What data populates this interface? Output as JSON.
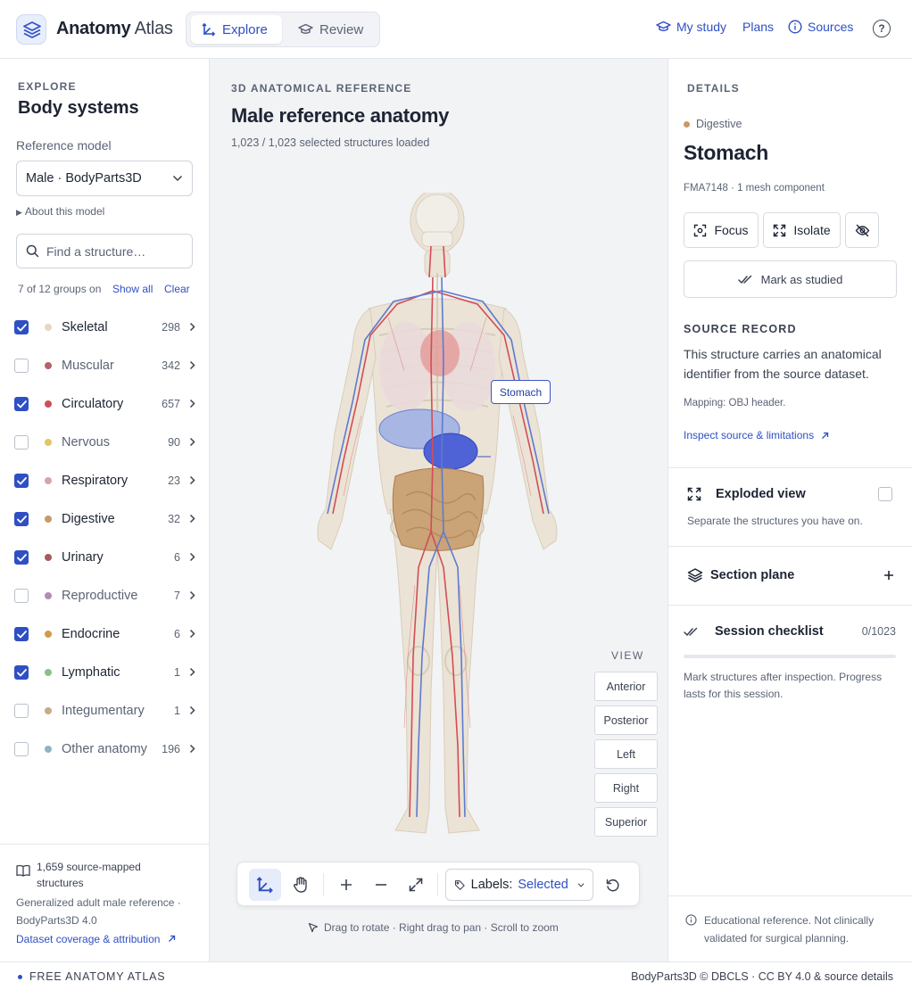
{
  "app": {
    "brand_bold": "Anatomy",
    "brand_light": "Atlas"
  },
  "modes": [
    {
      "label": "Explore",
      "active": true
    },
    {
      "label": "Review",
      "active": false
    }
  ],
  "toplinks": {
    "my_study": "My study",
    "plans": "Plans",
    "sources": "Sources",
    "help": "?"
  },
  "sidebar": {
    "eyebrow": "EXPLORE",
    "title": "Body systems",
    "model_label": "Reference model",
    "model_value": "Male · BodyParts3D",
    "about": "About this model",
    "search_placeholder": "Find a structure…",
    "group_summary": "7 of 12 groups on",
    "show_all": "Show all",
    "clear": "Clear",
    "groups": [
      {
        "name": "Skeletal",
        "count": "298",
        "on": true,
        "color": "#e6d9bf"
      },
      {
        "name": "Muscular",
        "count": "342",
        "on": false,
        "color": "#b5636a"
      },
      {
        "name": "Circulatory",
        "count": "657",
        "on": true,
        "color": "#d24d57"
      },
      {
        "name": "Nervous",
        "count": "90",
        "on": false,
        "color": "#e1c760"
      },
      {
        "name": "Respiratory",
        "count": "23",
        "on": true,
        "color": "#d9a3a7"
      },
      {
        "name": "Digestive",
        "count": "32",
        "on": true,
        "color": "#c79a6a"
      },
      {
        "name": "Urinary",
        "count": "6",
        "on": true,
        "color": "#a65a5e"
      },
      {
        "name": "Reproductive",
        "count": "7",
        "on": false,
        "color": "#b48bb5"
      },
      {
        "name": "Endocrine",
        "count": "6",
        "on": true,
        "color": "#d29a4a"
      },
      {
        "name": "Lymphatic",
        "count": "1",
        "on": true,
        "color": "#8dbf8b"
      },
      {
        "name": "Integumentary",
        "count": "1",
        "on": false,
        "color": "#c8ab87"
      },
      {
        "name": "Other anatomy",
        "count": "196",
        "on": false,
        "color": "#8db5c3"
      }
    ],
    "footer": {
      "mapped": "1,659 source-mapped structures",
      "desc": "Generalized adult male reference · BodyParts3D 4.0",
      "link": "Dataset coverage & attribution"
    }
  },
  "main": {
    "eyebrow": "3D ANATOMICAL REFERENCE",
    "title": "Male reference anatomy",
    "sub": "1,023 / 1,023 selected structures loaded",
    "callout": "Stomach",
    "view_label": "VIEW",
    "views": [
      "Anterior",
      "Posterior",
      "Left",
      "Right",
      "Superior"
    ],
    "labels_prefix": "Labels:",
    "labels_value": "Selected",
    "hint": "Drag to rotate · Right drag to pan · Scroll to zoom"
  },
  "details": {
    "eyebrow": "DETAILS",
    "system": "Digestive",
    "system_color": "#c79a6a",
    "name": "Stomach",
    "id": "FMA7148 · 1 mesh component",
    "focus": "Focus",
    "isolate": "Isolate",
    "mark": "Mark as studied",
    "source_head": "SOURCE RECORD",
    "source_body": "This structure carries an anatomical identifier from the source dataset.",
    "mapping": "Mapping: OBJ header.",
    "inspect": "Inspect source & limitations",
    "exploded_title": "Exploded view",
    "exploded_sub": "Separate the structures you have on.",
    "section_title": "Section plane",
    "checklist_title": "Session checklist",
    "checklist_count": "0/1023",
    "checklist_progress": 0,
    "checklist_sub": "Mark structures after inspection. Progress lasts for this session.",
    "notice": "Educational reference. Not clinically validated for surgical planning."
  },
  "footer": {
    "left": "FREE ANATOMY ATLAS",
    "right": "BodyParts3D © DBCLS · CC BY 4.0 & source details"
  }
}
